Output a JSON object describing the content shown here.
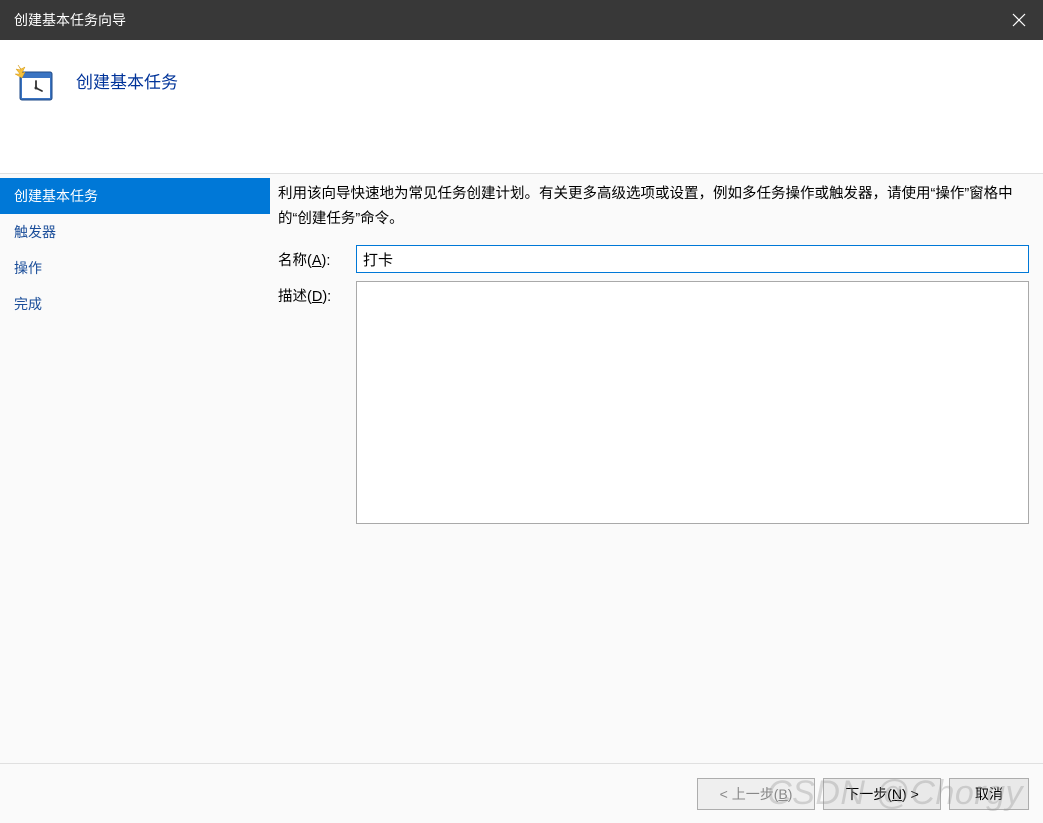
{
  "window": {
    "title": "创建基本任务向导"
  },
  "header": {
    "title": "创建基本任务"
  },
  "sidebar": {
    "items": [
      {
        "label": "创建基本任务",
        "selected": true
      },
      {
        "label": "触发器",
        "selected": false
      },
      {
        "label": "操作",
        "selected": false
      },
      {
        "label": "完成",
        "selected": false
      }
    ]
  },
  "content": {
    "intro": "利用该向导快速地为常见任务创建计划。有关更多高级选项或设置，例如多任务操作或触发器，请使用“操作”窗格中的“创建任务”命令。",
    "name_label_pre": "名称(",
    "name_label_u": "A",
    "name_label_post": "):",
    "name_value": "打卡",
    "desc_label_pre": "描述(",
    "desc_label_u": "D",
    "desc_label_post": "):",
    "desc_value": ""
  },
  "footer": {
    "prev_pre": "< 上一步(",
    "prev_u": "B",
    "prev_post": ")",
    "next_pre": "下一步(",
    "next_u": "N",
    "next_post": ") >",
    "cancel": "取消"
  },
  "watermark": "CSDN @Chorgy"
}
